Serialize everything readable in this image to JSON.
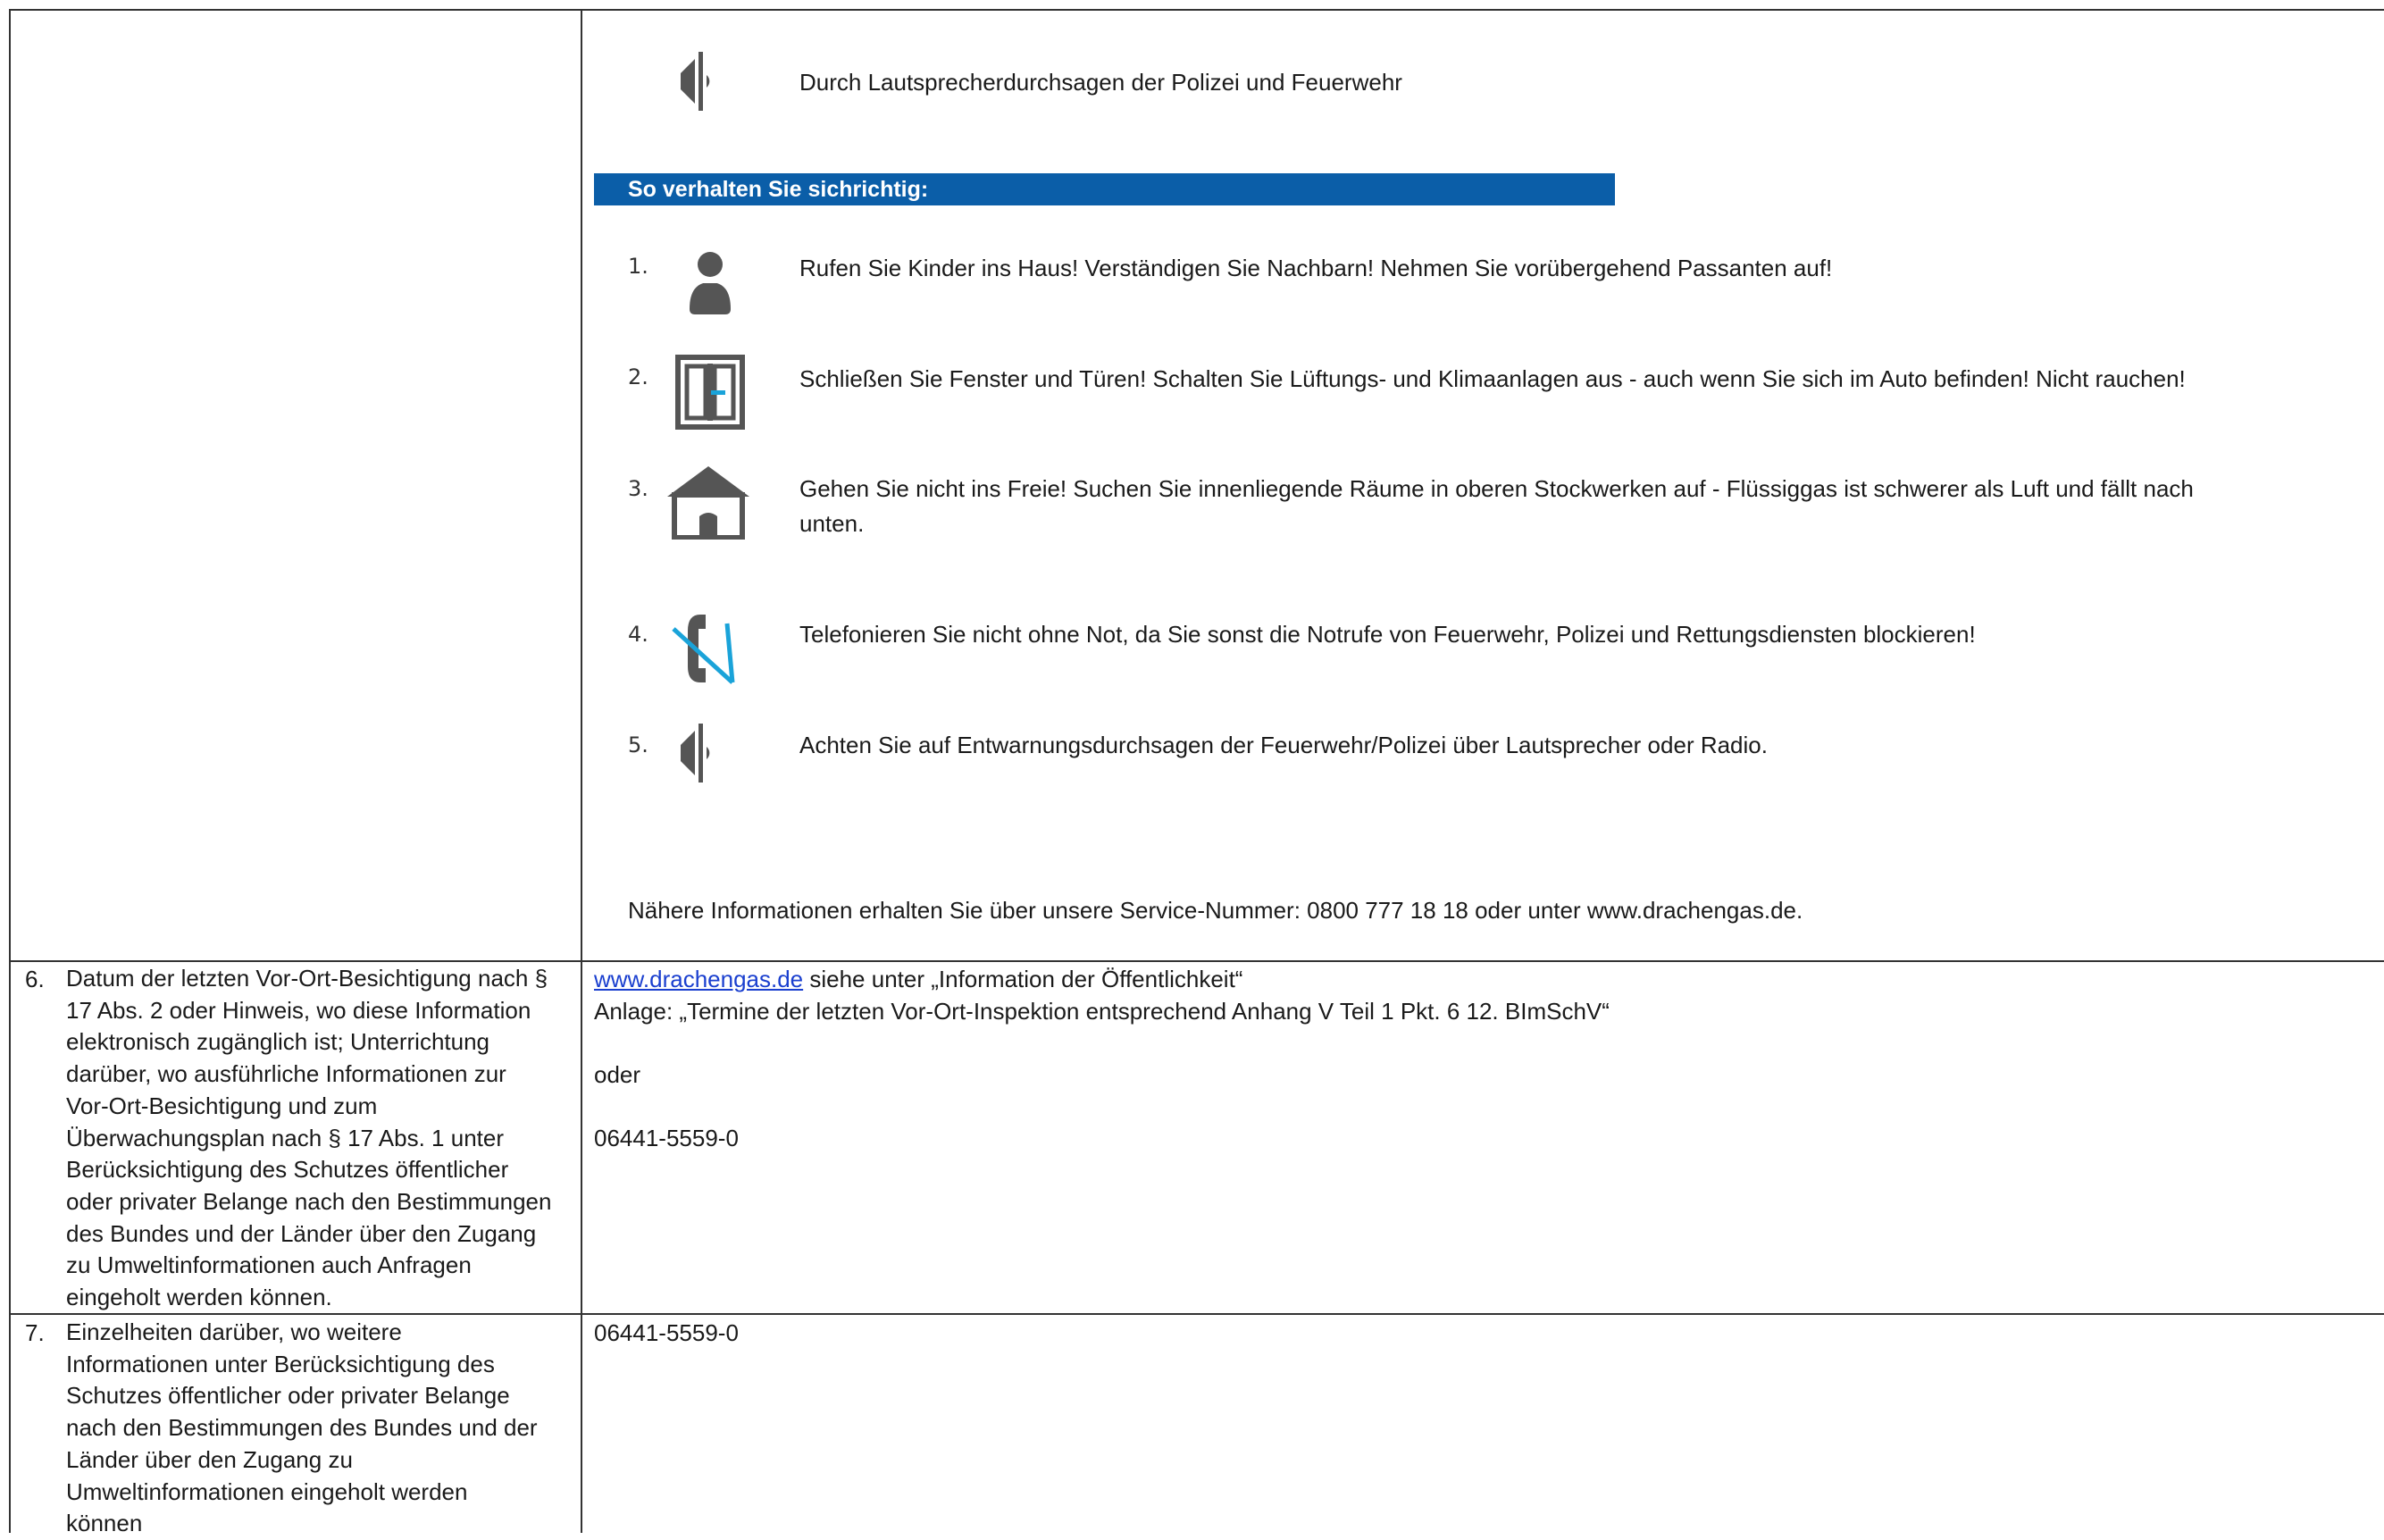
{
  "top_cell": {
    "intro": "Durch Lautsprecherdurchsagen der Polizei und Feuerwehr",
    "heading": "So verhalten Sie sichrichtig:",
    "steps": [
      {
        "num": "1.",
        "icon": "person-icon",
        "text": "Rufen Sie Kinder ins Haus! Verständigen Sie Nachbarn! Nehmen Sie vorübergehend Passanten auf!"
      },
      {
        "num": "2.",
        "icon": "door-window-icon",
        "text": "Schließen Sie Fenster und Türen! Schalten Sie Lüftungs- und Klimaanlagen aus - auch wenn Sie sich im Auto befinden! Nicht rauchen!"
      },
      {
        "num": "3.",
        "icon": "house-icon",
        "text": "Gehen Sie nicht ins Freie! Suchen Sie innenliegende Räume in oberen Stockwerken auf - Flüssiggas ist schwerer als Luft und fällt nach",
        "text2": "unten."
      },
      {
        "num": "4.",
        "icon": "no-phone-icon",
        "text": "Telefonieren Sie nicht ohne Not, da Sie sonst die Notrufe von Feuerwehr, Polizei und Rettungsdiensten blockieren!"
      },
      {
        "num": "5.",
        "icon": "speaker-icon",
        "text": "Achten Sie auf Entwarnungsdurchsagen der Feuerwehr/Polizei über Lautsprecher oder Radio."
      }
    ],
    "footer": "Nähere Informationen erhalten Sie über unsere Service-Nummer: 0800 777 18 18 oder unter www.drachengas.de."
  },
  "row6": {
    "num": "6.",
    "left_lines": [
      "Datum der letzten Vor-Ort-Besichtigung nach §",
      "17 Abs. 2 oder Hinweis, wo diese Information",
      "elektronisch zugänglich ist; Unterrichtung",
      "darüber, wo ausführliche Informationen zur",
      "Vor-Ort-Besichtigung und zum",
      "Überwachungsplan nach § 17 Abs. 1 unter",
      "Berücksichtigung des Schutzes öffentlicher",
      "oder privater Belange nach den Bestimmungen",
      "des Bundes und der Länder über den Zugang",
      "zu Umweltinformationen auch Anfragen",
      "eingeholt werden können."
    ],
    "link": "www.drachengas.de",
    "link_suffix": " siehe unter „Information der Öffentlichkeit“",
    "anlage": "Anlage: „Termine der letzten Vor-Ort-Inspektion entsprechend Anhang V Teil 1 Pkt. 6 12. BImSchV“",
    "oder": "oder",
    "phone": "06441-5559-0"
  },
  "row7": {
    "num": "7.",
    "left_lines": [
      "Einzelheiten darüber, wo weitere",
      "Informationen unter Berücksichtigung des",
      "Schutzes öffentlicher oder privater Belange",
      "nach den Bestimmungen des Bundes und der",
      "Länder über den Zugang zu",
      "Umweltinformationen eingeholt werden",
      "können"
    ],
    "phone": "06441-5559-0"
  },
  "colors": {
    "heading_bar": "#0b5ea8",
    "icon_gray": "#555555",
    "accent_cyan": "#1aa3d9",
    "link": "#1a3fcf"
  }
}
